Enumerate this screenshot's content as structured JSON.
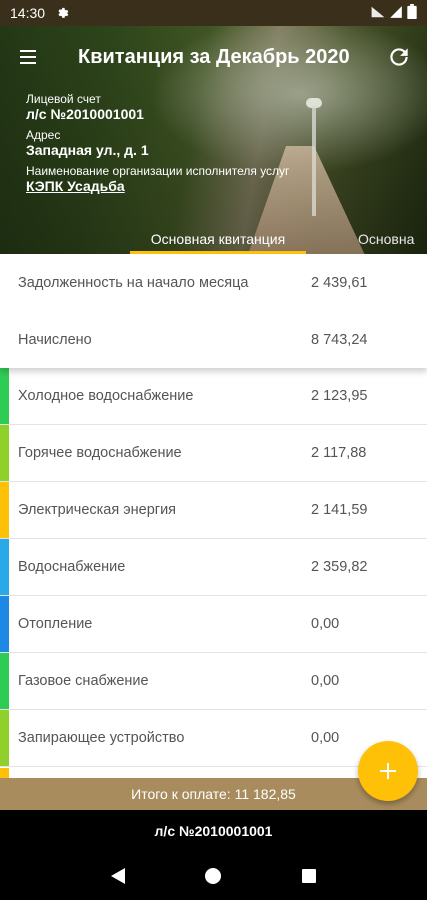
{
  "status_bar": {
    "time": "14:30"
  },
  "header": {
    "title": "Квитанция за Декабрь 2020",
    "account_label": "Лицевой счет",
    "account_value": "л/с №2010001001",
    "address_label": "Адрес",
    "address_value": "Западная ул., д. 1",
    "org_label": "Наименование организации исполнителя услуг",
    "org_value": "КЭПК Усадьба"
  },
  "tabs": [
    {
      "label": "Основная квитанция",
      "active": true
    },
    {
      "label": "Основна",
      "active": false
    }
  ],
  "summary": [
    {
      "name": "Задолженность на начало месяца",
      "amount": "2 439,61"
    },
    {
      "name": "Начислено",
      "amount": "8 743,24"
    }
  ],
  "services": [
    {
      "name": "Холодное водоснабжение",
      "amount": "2 123,95",
      "color": "#2fcc55"
    },
    {
      "name": "Горячее водоснабжение",
      "amount": "2 117,88",
      "color": "#8fd12a"
    },
    {
      "name": "Электрическая энергия",
      "amount": "2 141,59",
      "color": "#ffc107"
    },
    {
      "name": "Водоснабжение",
      "amount": "2 359,82",
      "color": "#29a9e8"
    },
    {
      "name": "Отопление",
      "amount": "0,00",
      "color": "#1e88e5"
    },
    {
      "name": "Газовое снабжение",
      "amount": "0,00",
      "color": "#2fcc55"
    },
    {
      "name": "Запирающее устройство",
      "amount": "0,00",
      "color": "#8fd12a"
    }
  ],
  "total": {
    "text": "Итого к оплате: 11 182,85"
  },
  "account_bar": {
    "text": "л/с №2010001001"
  },
  "fab": {
    "icon": "plus-icon",
    "color": "#ffc107"
  }
}
